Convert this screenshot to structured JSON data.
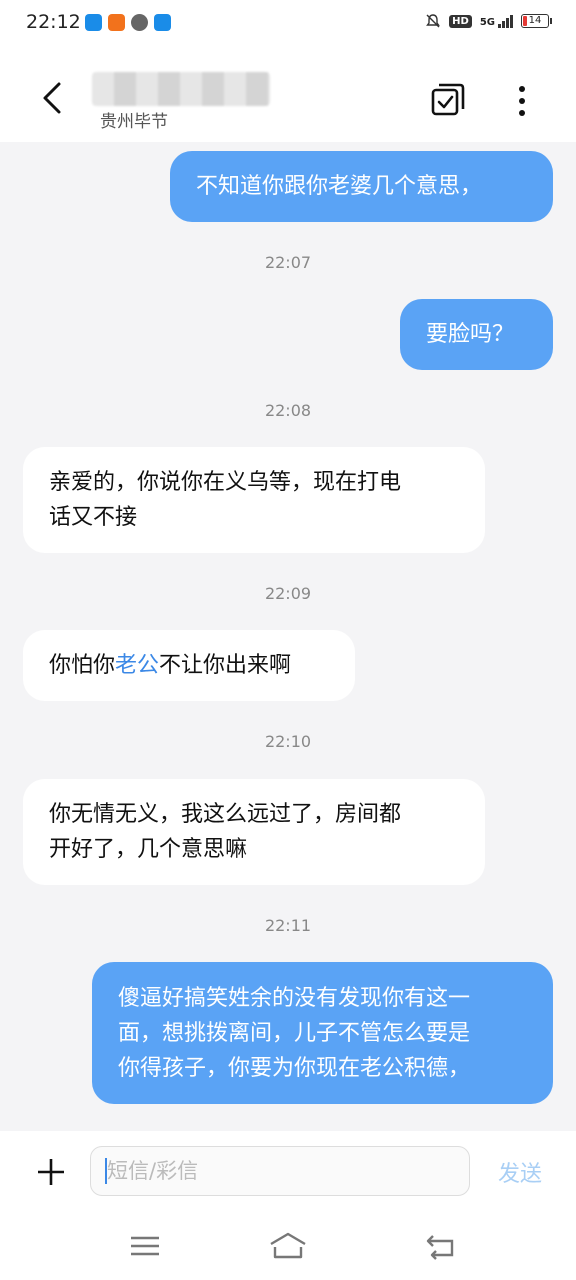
{
  "status_bar": {
    "time": "22:12",
    "network": "5G",
    "hd_label": "HD",
    "battery": "14",
    "app_icons": [
      {
        "name": "app-notify-icon",
        "color": "#1a8ce8"
      },
      {
        "name": "app-news-icon",
        "color": "#f2721c"
      },
      {
        "name": "app-media-icon",
        "color": "#666666"
      },
      {
        "name": "app-alipay-icon",
        "color": "#1a8ce8"
      }
    ]
  },
  "header": {
    "location": "贵州毕节"
  },
  "messages": [
    {
      "text": "不知道你跟你老婆几个意思，"
    },
    {
      "time": "22:07"
    },
    {
      "text": "要脸吗？"
    },
    {
      "time": "22:08"
    },
    {
      "text_line1": "亲爱的，你说你在义乌等，现在打电",
      "text_line2": "话又不接"
    },
    {
      "time": "22:09"
    },
    {
      "pre": "你怕你",
      "highlight": "老公",
      "post": "不让你出来啊"
    },
    {
      "time": "22:10"
    },
    {
      "text_line1": "你无情无义，我这么远过了，房间都",
      "text_line2": "开好了，几个意思嘛"
    },
    {
      "time": "22:11"
    },
    {
      "text_line1": "傻逼好搞笑姓余的没有发现你有这一",
      "text_line2": "面，想挑拨离间，儿子不管怎么要是",
      "text_line3": "你得孩子，你要为你现在老公积德，"
    }
  ],
  "input": {
    "placeholder": "短信/彩信",
    "send_label": "发送"
  },
  "colors": {
    "sent_bubble": "#5aa3f5",
    "received_bubble": "#ffffff",
    "background": "#f4f4f6",
    "link": "#3b88e6"
  }
}
